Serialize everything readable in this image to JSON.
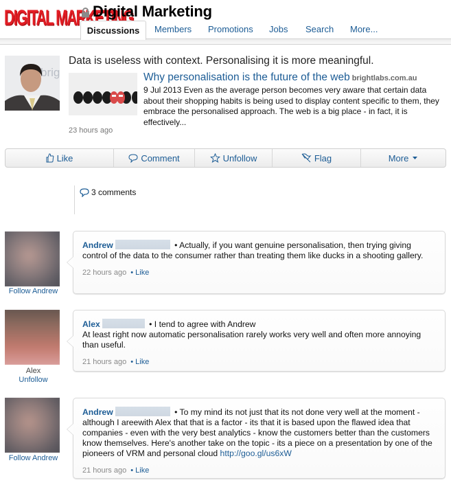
{
  "header": {
    "logo_text": "DIGITAL MARKETING",
    "group_title": "Digital Marketing",
    "lock_icon": "lock-icon"
  },
  "tabs": [
    {
      "label": "Discussions",
      "active": true
    },
    {
      "label": "Members",
      "active": false
    },
    {
      "label": "Promotions",
      "active": false
    },
    {
      "label": "Jobs",
      "active": false
    },
    {
      "label": "Search",
      "active": false
    },
    {
      "label": "More...",
      "active": false
    }
  ],
  "post": {
    "text": "Data is useless with context. Personalising it is more meaningful.",
    "article": {
      "title": "Why personalisation is the future of the web",
      "source": "brightlabs.com.au",
      "snippet": "9 Jul 2013 Even as the average person becomes very aware that certain data about their shopping habits is being used to display content specific to them, they embrace the personalised approach. The web is a big place - in fact, it is effectively..."
    },
    "time": "23 hours ago"
  },
  "actions": [
    {
      "label": "Like",
      "icon": "thumbs-up-icon"
    },
    {
      "label": "Comment",
      "icon": "speech-bubble-icon"
    },
    {
      "label": "Unfollow",
      "icon": "star-icon"
    },
    {
      "label": "Flag",
      "icon": "flag-icon"
    },
    {
      "label": "More",
      "icon": "caret-down-icon"
    }
  ],
  "comments_count": "3 comments",
  "comments": [
    {
      "author": "Andrew",
      "text": "• Actually, if you want genuine personalisation, then trying giving control of the data to the consumer rather than treating them like ducks in a shooting gallery.",
      "time": "22 hours ago",
      "like_label": "• Like",
      "follow_label": "Follow Andrew"
    },
    {
      "author": "Alex",
      "text_line1": "• I tend to agree with Andrew",
      "text": "At least right now automatic personalisation rarely works very well and often more annoying than useful.",
      "time": "21 hours ago",
      "like_label": "• Like",
      "name_label": "Alex",
      "follow_label": "Unfollow"
    },
    {
      "author": "Andrew",
      "text": "• To my mind its not just that its not done very well at the moment - although I areewith Alex that that is a factor - its that it is based upon the flawed idea that companies - even with the very best analytics - know the customers better than the customers know themselves. Here's another take on the topic - its a piece on a presentation by one of the pioneers of VRM and personal cloud",
      "link": "http://goo.gl/us6xW",
      "time": "21 hours ago",
      "like_label": "• Like",
      "follow_label": "Follow Andrew"
    }
  ],
  "colors": {
    "link": "#1c5c95",
    "logo_red": "#e21d24",
    "meta_gray": "#777777"
  }
}
